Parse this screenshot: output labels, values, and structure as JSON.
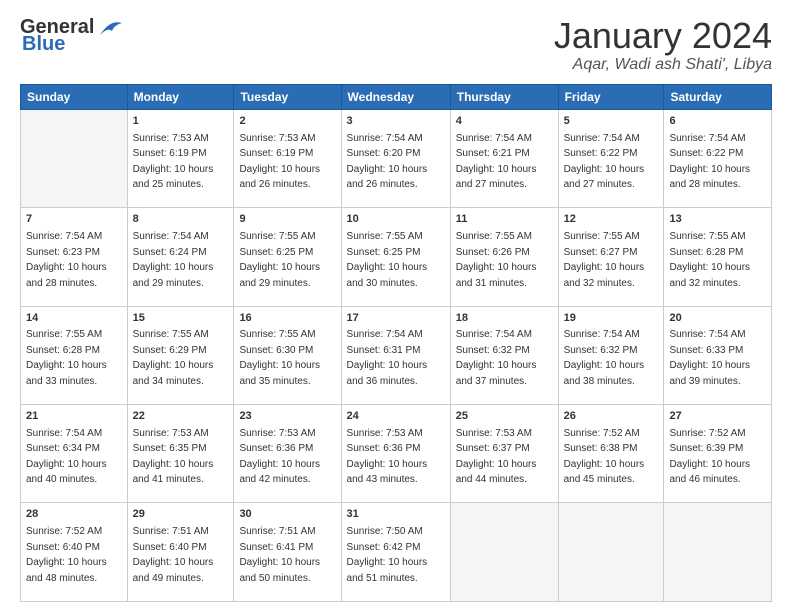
{
  "header": {
    "logo_general": "General",
    "logo_blue": "Blue",
    "month": "January 2024",
    "location": "Aqar, Wadi ash Shati', Libya"
  },
  "days_of_week": [
    "Sunday",
    "Monday",
    "Tuesday",
    "Wednesday",
    "Thursday",
    "Friday",
    "Saturday"
  ],
  "weeks": [
    [
      {
        "day": "",
        "info": ""
      },
      {
        "day": "1",
        "info": "Sunrise: 7:53 AM\nSunset: 6:19 PM\nDaylight: 10 hours\nand 25 minutes."
      },
      {
        "day": "2",
        "info": "Sunrise: 7:53 AM\nSunset: 6:19 PM\nDaylight: 10 hours\nand 26 minutes."
      },
      {
        "day": "3",
        "info": "Sunrise: 7:54 AM\nSunset: 6:20 PM\nDaylight: 10 hours\nand 26 minutes."
      },
      {
        "day": "4",
        "info": "Sunrise: 7:54 AM\nSunset: 6:21 PM\nDaylight: 10 hours\nand 27 minutes."
      },
      {
        "day": "5",
        "info": "Sunrise: 7:54 AM\nSunset: 6:22 PM\nDaylight: 10 hours\nand 27 minutes."
      },
      {
        "day": "6",
        "info": "Sunrise: 7:54 AM\nSunset: 6:22 PM\nDaylight: 10 hours\nand 28 minutes."
      }
    ],
    [
      {
        "day": "7",
        "info": "Sunrise: 7:54 AM\nSunset: 6:23 PM\nDaylight: 10 hours\nand 28 minutes."
      },
      {
        "day": "8",
        "info": "Sunrise: 7:54 AM\nSunset: 6:24 PM\nDaylight: 10 hours\nand 29 minutes."
      },
      {
        "day": "9",
        "info": "Sunrise: 7:55 AM\nSunset: 6:25 PM\nDaylight: 10 hours\nand 29 minutes."
      },
      {
        "day": "10",
        "info": "Sunrise: 7:55 AM\nSunset: 6:25 PM\nDaylight: 10 hours\nand 30 minutes."
      },
      {
        "day": "11",
        "info": "Sunrise: 7:55 AM\nSunset: 6:26 PM\nDaylight: 10 hours\nand 31 minutes."
      },
      {
        "day": "12",
        "info": "Sunrise: 7:55 AM\nSunset: 6:27 PM\nDaylight: 10 hours\nand 32 minutes."
      },
      {
        "day": "13",
        "info": "Sunrise: 7:55 AM\nSunset: 6:28 PM\nDaylight: 10 hours\nand 32 minutes."
      }
    ],
    [
      {
        "day": "14",
        "info": "Sunrise: 7:55 AM\nSunset: 6:28 PM\nDaylight: 10 hours\nand 33 minutes."
      },
      {
        "day": "15",
        "info": "Sunrise: 7:55 AM\nSunset: 6:29 PM\nDaylight: 10 hours\nand 34 minutes."
      },
      {
        "day": "16",
        "info": "Sunrise: 7:55 AM\nSunset: 6:30 PM\nDaylight: 10 hours\nand 35 minutes."
      },
      {
        "day": "17",
        "info": "Sunrise: 7:54 AM\nSunset: 6:31 PM\nDaylight: 10 hours\nand 36 minutes."
      },
      {
        "day": "18",
        "info": "Sunrise: 7:54 AM\nSunset: 6:32 PM\nDaylight: 10 hours\nand 37 minutes."
      },
      {
        "day": "19",
        "info": "Sunrise: 7:54 AM\nSunset: 6:32 PM\nDaylight: 10 hours\nand 38 minutes."
      },
      {
        "day": "20",
        "info": "Sunrise: 7:54 AM\nSunset: 6:33 PM\nDaylight: 10 hours\nand 39 minutes."
      }
    ],
    [
      {
        "day": "21",
        "info": "Sunrise: 7:54 AM\nSunset: 6:34 PM\nDaylight: 10 hours\nand 40 minutes."
      },
      {
        "day": "22",
        "info": "Sunrise: 7:53 AM\nSunset: 6:35 PM\nDaylight: 10 hours\nand 41 minutes."
      },
      {
        "day": "23",
        "info": "Sunrise: 7:53 AM\nSunset: 6:36 PM\nDaylight: 10 hours\nand 42 minutes."
      },
      {
        "day": "24",
        "info": "Sunrise: 7:53 AM\nSunset: 6:36 PM\nDaylight: 10 hours\nand 43 minutes."
      },
      {
        "day": "25",
        "info": "Sunrise: 7:53 AM\nSunset: 6:37 PM\nDaylight: 10 hours\nand 44 minutes."
      },
      {
        "day": "26",
        "info": "Sunrise: 7:52 AM\nSunset: 6:38 PM\nDaylight: 10 hours\nand 45 minutes."
      },
      {
        "day": "27",
        "info": "Sunrise: 7:52 AM\nSunset: 6:39 PM\nDaylight: 10 hours\nand 46 minutes."
      }
    ],
    [
      {
        "day": "28",
        "info": "Sunrise: 7:52 AM\nSunset: 6:40 PM\nDaylight: 10 hours\nand 48 minutes."
      },
      {
        "day": "29",
        "info": "Sunrise: 7:51 AM\nSunset: 6:40 PM\nDaylight: 10 hours\nand 49 minutes."
      },
      {
        "day": "30",
        "info": "Sunrise: 7:51 AM\nSunset: 6:41 PM\nDaylight: 10 hours\nand 50 minutes."
      },
      {
        "day": "31",
        "info": "Sunrise: 7:50 AM\nSunset: 6:42 PM\nDaylight: 10 hours\nand 51 minutes."
      },
      {
        "day": "",
        "info": ""
      },
      {
        "day": "",
        "info": ""
      },
      {
        "day": "",
        "info": ""
      }
    ]
  ]
}
